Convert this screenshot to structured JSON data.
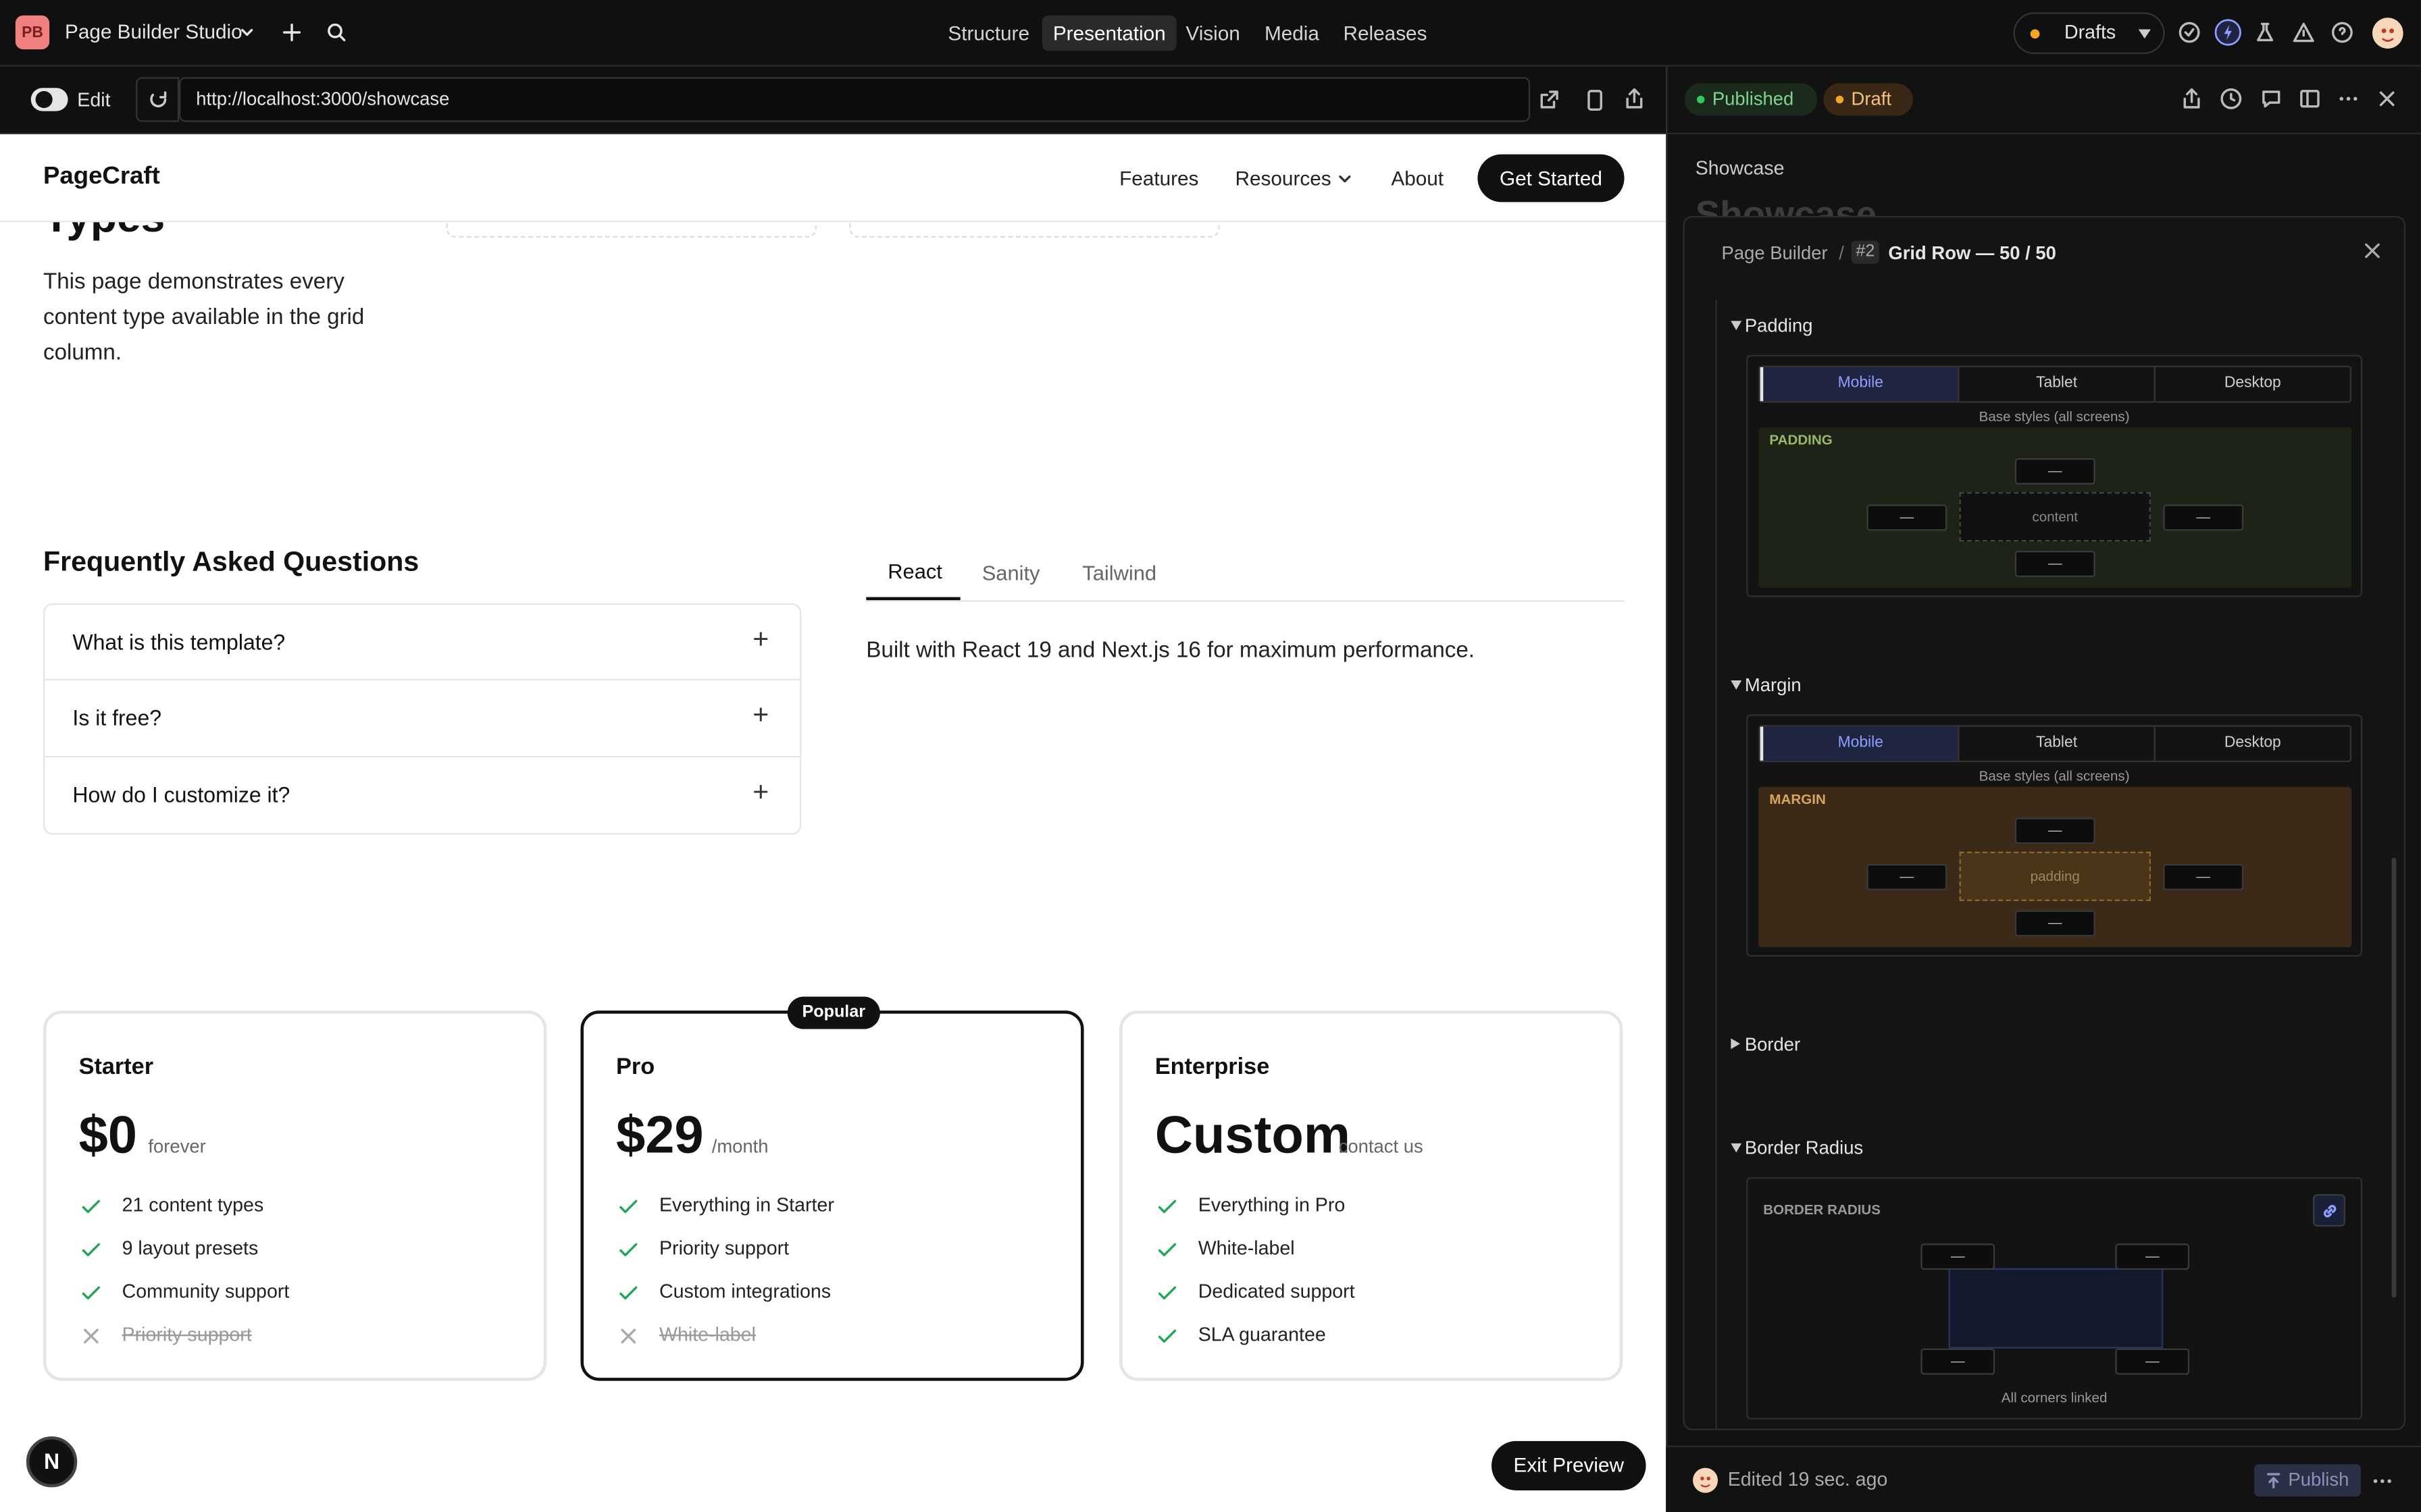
{
  "topbar": {
    "logo": "PB",
    "app_name": "Page Builder Studio",
    "nav": [
      "Structure",
      "Presentation",
      "Vision",
      "Media",
      "Releases"
    ],
    "active_nav": "Presentation",
    "drafts_label": "Drafts"
  },
  "urlbar": {
    "edit_label": "Edit",
    "url": "http://localhost:3000/showcase"
  },
  "site": {
    "brand": "PageCraft",
    "nav": [
      "Features",
      "Resources",
      "About"
    ],
    "cta": "Get Started",
    "intro_heading_fragment": "Types",
    "intro_text": [
      "This page demonstrates every",
      "content type available in the grid",
      "column."
    ],
    "faq_title": "Frequently Asked Questions",
    "faq": [
      "What is this template?",
      "Is it free?",
      "How do I customize it?"
    ],
    "tabs": [
      "React",
      "Sanity",
      "Tailwind"
    ],
    "active_tab": "React",
    "tab_content": "Built with React 19 and Next.js 16 for maximum performance.",
    "pricing": [
      {
        "name": "Starter",
        "price": "$0",
        "period": "forever",
        "popular": false,
        "features": [
          {
            "text": "21 content types",
            "on": true
          },
          {
            "text": "9 layout presets",
            "on": true
          },
          {
            "text": "Community support",
            "on": true
          },
          {
            "text": "Priority support",
            "on": false
          }
        ]
      },
      {
        "name": "Pro",
        "price": "$29",
        "period": "/month",
        "popular": true,
        "badge": "Popular",
        "features": [
          {
            "text": "Everything in Starter",
            "on": true
          },
          {
            "text": "Priority support",
            "on": true
          },
          {
            "text": "Custom integrations",
            "on": true
          },
          {
            "text": "White-label",
            "on": false
          }
        ]
      },
      {
        "name": "Enterprise",
        "price": "Custom",
        "period": "contact us",
        "popular": false,
        "features": [
          {
            "text": "Everything in Pro",
            "on": true
          },
          {
            "text": "White-label",
            "on": true
          },
          {
            "text": "Dedicated support",
            "on": true
          },
          {
            "text": "SLA guarantee",
            "on": true
          }
        ]
      }
    ],
    "exit_preview": "Exit Preview",
    "next_badge": "N"
  },
  "panel": {
    "status_published": "Published",
    "status_draft": "Draft",
    "doc_title": "Showcase",
    "doc_heading_faded": "Showcase",
    "breadcrumb_root": "Page Builder",
    "breadcrumb_index": "#2",
    "breadcrumb_item": "Grid Row — 50 / 50",
    "sections": {
      "padding": "Padding",
      "margin": "Margin",
      "border": "Border",
      "radius": "Border Radius"
    },
    "devices": [
      "Mobile",
      "Tablet",
      "Desktop"
    ],
    "base_note": "Base styles (all screens)",
    "padding_label": "PADDING",
    "padding_inner": "content",
    "margin_label": "MARGIN",
    "margin_inner": "padding",
    "radius_label": "BORDER RADIUS",
    "radius_note": "All corners linked",
    "empty_value": "—",
    "footer_edited": "Edited 19 sec. ago",
    "publish": "Publish"
  },
  "colors": {
    "padding_fill": "#1d2417",
    "padding_label": "#9ab86a",
    "margin_fill": "#3a2a17",
    "margin_label": "#d9a55a",
    "published_dot": "#34c759",
    "draft_dot": "#f5a623",
    "check": "#22a55a",
    "accent": "#8ea0ff"
  }
}
